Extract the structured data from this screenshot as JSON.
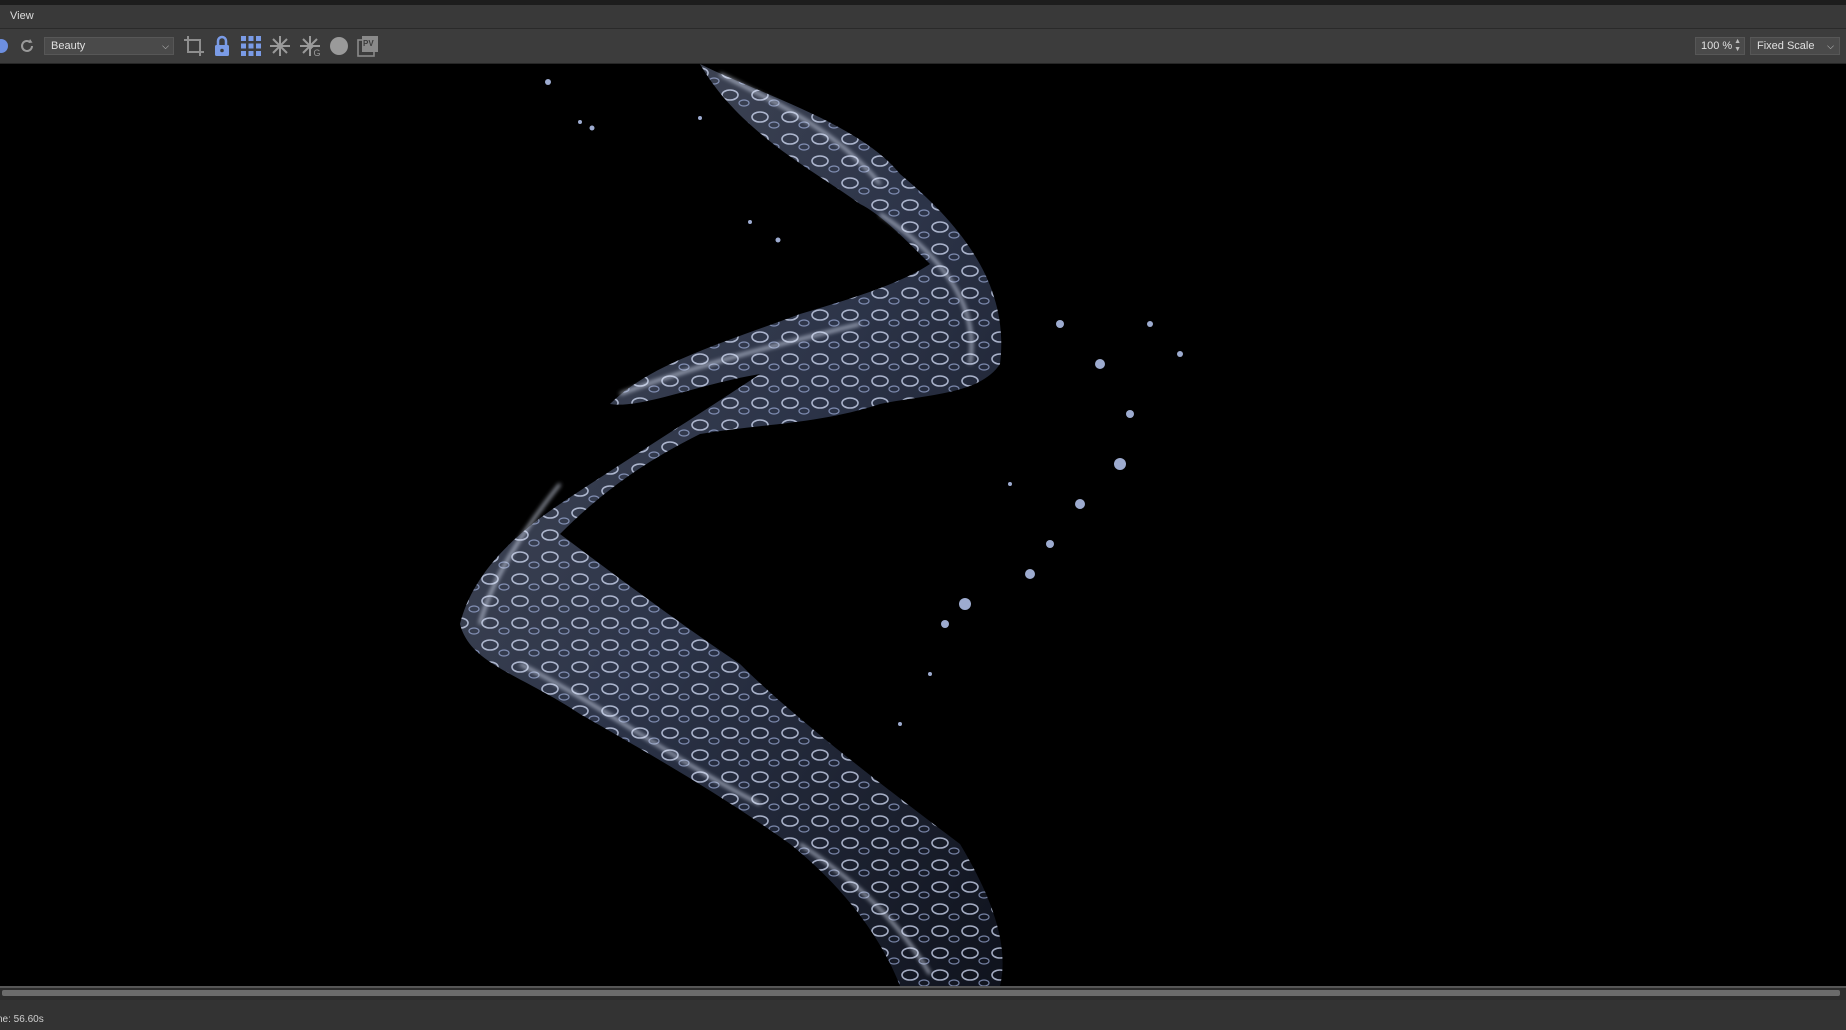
{
  "menubar": {
    "view_label": "View"
  },
  "toolbar": {
    "icons": [
      "play-icon",
      "refresh-icon",
      "crop-icon",
      "lock-icon",
      "grid-icon",
      "snowflake-icon",
      "snowflake-g-icon",
      "sphere-icon",
      "pv-icon"
    ],
    "pass_select": {
      "value": "Beauty"
    },
    "zoom": {
      "value": "100 %"
    },
    "scale_select": {
      "value": "Fixed Scale"
    },
    "pv_label": "PV"
  },
  "viewport": {
    "content": "rendered-liquid-image",
    "background": "#000000",
    "liquid_color": "#9fb4e8"
  },
  "statusbar": {
    "text": "ne: 56.60s"
  },
  "colors": {
    "accent": "#6d8fe0",
    "panel": "#3c3c3c"
  }
}
